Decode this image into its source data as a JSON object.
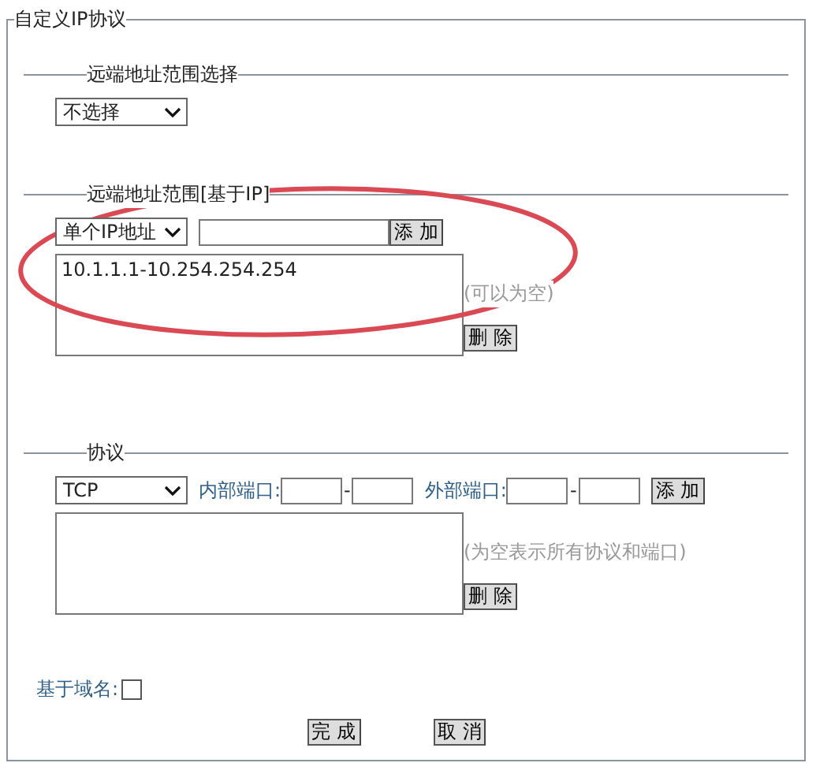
{
  "panel": {
    "title": "自定义IP协议"
  },
  "remote_range_select": {
    "title": "远端地址范围选择",
    "dropdown": "不选择"
  },
  "remote_range_ip": {
    "title": "远端地址范围[基于IP]",
    "type_dropdown": "单个IP地址",
    "add_button": "添 加",
    "entries": [
      "10.1.1.1-10.254.254.254"
    ],
    "hint": "(可以为空)",
    "delete_button": "删 除"
  },
  "protocol": {
    "title": "协议",
    "dropdown": "TCP",
    "ports": [
      {
        "label": "内部端口:",
        "separator": "-"
      },
      {
        "label": "外部端口:",
        "separator": "-"
      }
    ],
    "add_button": "添 加",
    "hint": "(为空表示所有协议和端口)",
    "delete_button": "删 除"
  },
  "domain": {
    "label": "基于域名:",
    "checked": false
  },
  "buttons": [
    "完 成",
    "取 消"
  ]
}
